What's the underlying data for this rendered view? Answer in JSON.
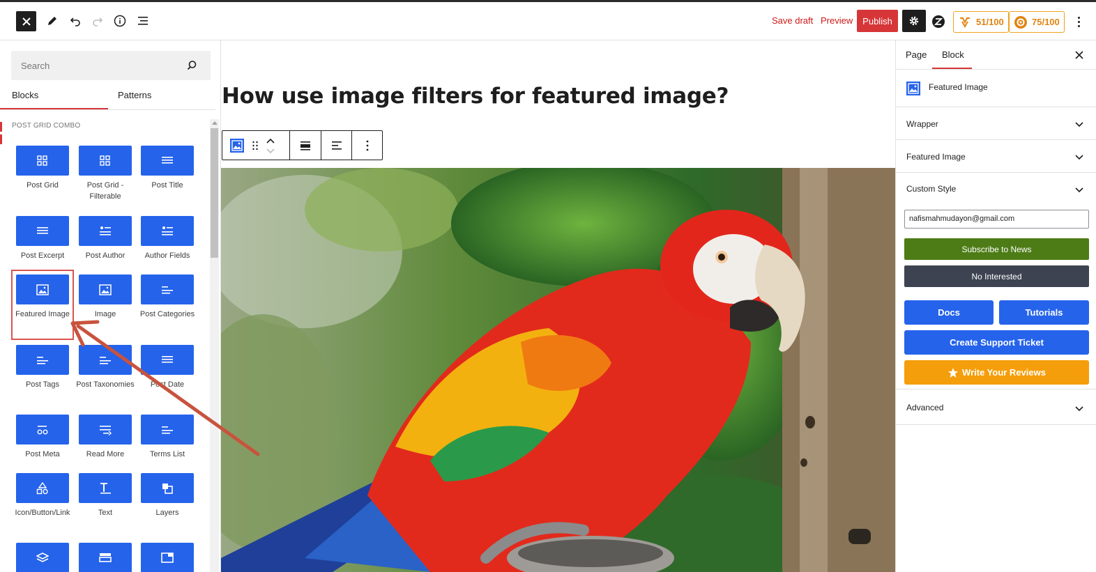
{
  "toolbar": {
    "save_draft": "Save draft",
    "preview": "Preview",
    "publish": "Publish",
    "score_one": "51/100",
    "score_two": "75/100"
  },
  "inserter": {
    "search_placeholder": "Search",
    "tabs": [
      "Blocks",
      "Patterns"
    ],
    "category": "POST GRID COMBO",
    "blocks": [
      {
        "label": "Post Grid",
        "icon": "grid-icon"
      },
      {
        "label": "Post Grid - Filterable",
        "icon": "grid-icon"
      },
      {
        "label": "Post Title",
        "icon": "lines-icon"
      },
      {
        "label": "Post Excerpt",
        "icon": "lines-icon"
      },
      {
        "label": "Post Author",
        "icon": "author-icon"
      },
      {
        "label": "Author Fields",
        "icon": "author-icon"
      },
      {
        "label": "Featured Image",
        "icon": "image-icon"
      },
      {
        "label": "Image",
        "icon": "image-icon"
      },
      {
        "label": "Post Categories",
        "icon": "short-lines-icon"
      },
      {
        "label": "Post Tags",
        "icon": "short-lines-icon"
      },
      {
        "label": "Post Taxonomies",
        "icon": "short-lines-icon"
      },
      {
        "label": "Post Date",
        "icon": "lines-icon"
      },
      {
        "label": "Post Meta",
        "icon": "meta-icon"
      },
      {
        "label": "Read More",
        "icon": "read-more-icon"
      },
      {
        "label": "Terms List",
        "icon": "short-lines-icon"
      },
      {
        "label": "Icon/Button/Link",
        "icon": "shapes-icon"
      },
      {
        "label": "Text",
        "icon": "text-icon"
      },
      {
        "label": "Layers",
        "icon": "layers-icon"
      },
      {
        "label": "",
        "icon": "stack-icon"
      },
      {
        "label": "",
        "icon": "layout-icon"
      },
      {
        "label": "",
        "icon": "window-icon"
      }
    ],
    "highlight_color": "#d9534f"
  },
  "canvas": {
    "title": "How use image filters for featured image?"
  },
  "sidebar": {
    "tabs": [
      "Page",
      "Block"
    ],
    "block_card": "Featured Image",
    "panels": [
      "Wrapper",
      "Featured Image",
      "Custom Style"
    ],
    "email_value": "nafismahmudayon@gmail.com",
    "subscribe": "Subscribe to News",
    "not_interested": "No Interested",
    "docs": "Docs",
    "tutorials": "Tutorials",
    "support": "Create Support Ticket",
    "reviews": "Write Your Reviews",
    "advanced": "Advanced"
  },
  "colors": {
    "accent_blue": "#2563eb",
    "publish_red": "#d63638",
    "score_orange": "#e0830f",
    "subscribe_green": "#4d7c17",
    "review_orange": "#f59e0b"
  }
}
